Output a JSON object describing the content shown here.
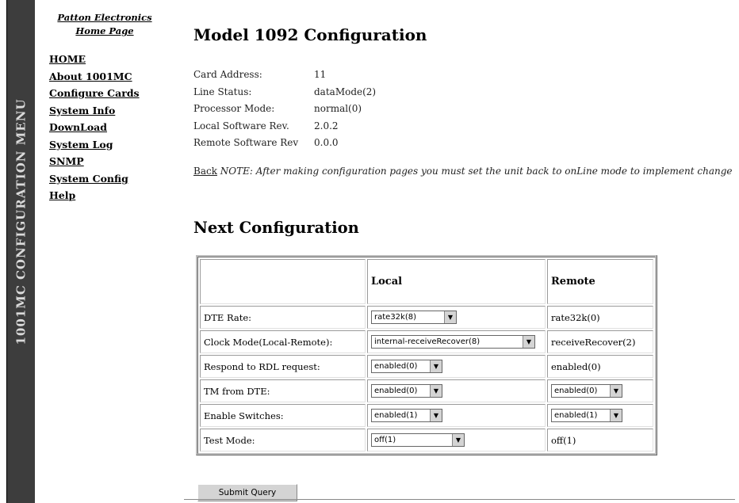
{
  "sidebar": {
    "vertical_title": "1001MC CONFIGURATION MENU"
  },
  "left_menu": {
    "company_line1": "Patton Electronics",
    "company_line2": "Home Page",
    "items": [
      "HOME",
      "About 1001MC",
      "Configure Cards",
      "System Info",
      "DownLoad",
      "System Log",
      "SNMP",
      "System Config",
      "Help"
    ]
  },
  "main": {
    "title": "Model 1092 Configuration",
    "info": [
      {
        "label": "Card Address:",
        "value": "11"
      },
      {
        "label": "Line Status:",
        "value": "dataMode(2)"
      },
      {
        "label": "Processor Mode:",
        "value": "normal(0)"
      },
      {
        "label": "Local Software Rev.",
        "value": "2.0.2"
      },
      {
        "label": "Remote Software Rev",
        "value": "0.0.0"
      }
    ],
    "back_link": "Back",
    "note": "NOTE: After making configuration pages you must set the unit back to onLine mode to implement change",
    "next_title": "Next Configuration"
  },
  "table": {
    "headers": [
      "",
      "Local",
      "Remote"
    ],
    "rows": [
      {
        "label": "DTE Rate:",
        "local": "rate32k(8)",
        "remote": "rate32k(0)"
      },
      {
        "label": "Clock Mode(Local-Remote):",
        "local": "internal-receiveRecover(8)",
        "remote": "receiveRecover(2)"
      },
      {
        "label": "Respond to RDL request:",
        "local": "enabled(0)",
        "remote": "enabled(0)"
      },
      {
        "label": "TM from DTE:",
        "local": "enabled(0)",
        "remote": "enabled(0)"
      },
      {
        "label": "Enable Switches:",
        "local": "enabled(1)",
        "remote": "enabled(1)"
      },
      {
        "label": "Test Mode:",
        "local": "off(1)",
        "remote": "off(1)"
      }
    ]
  },
  "submit_label": "Submit Query",
  "colors": {
    "sidebar_band": "#3d3d3d",
    "sidebar_text": "#d9d9d9"
  }
}
